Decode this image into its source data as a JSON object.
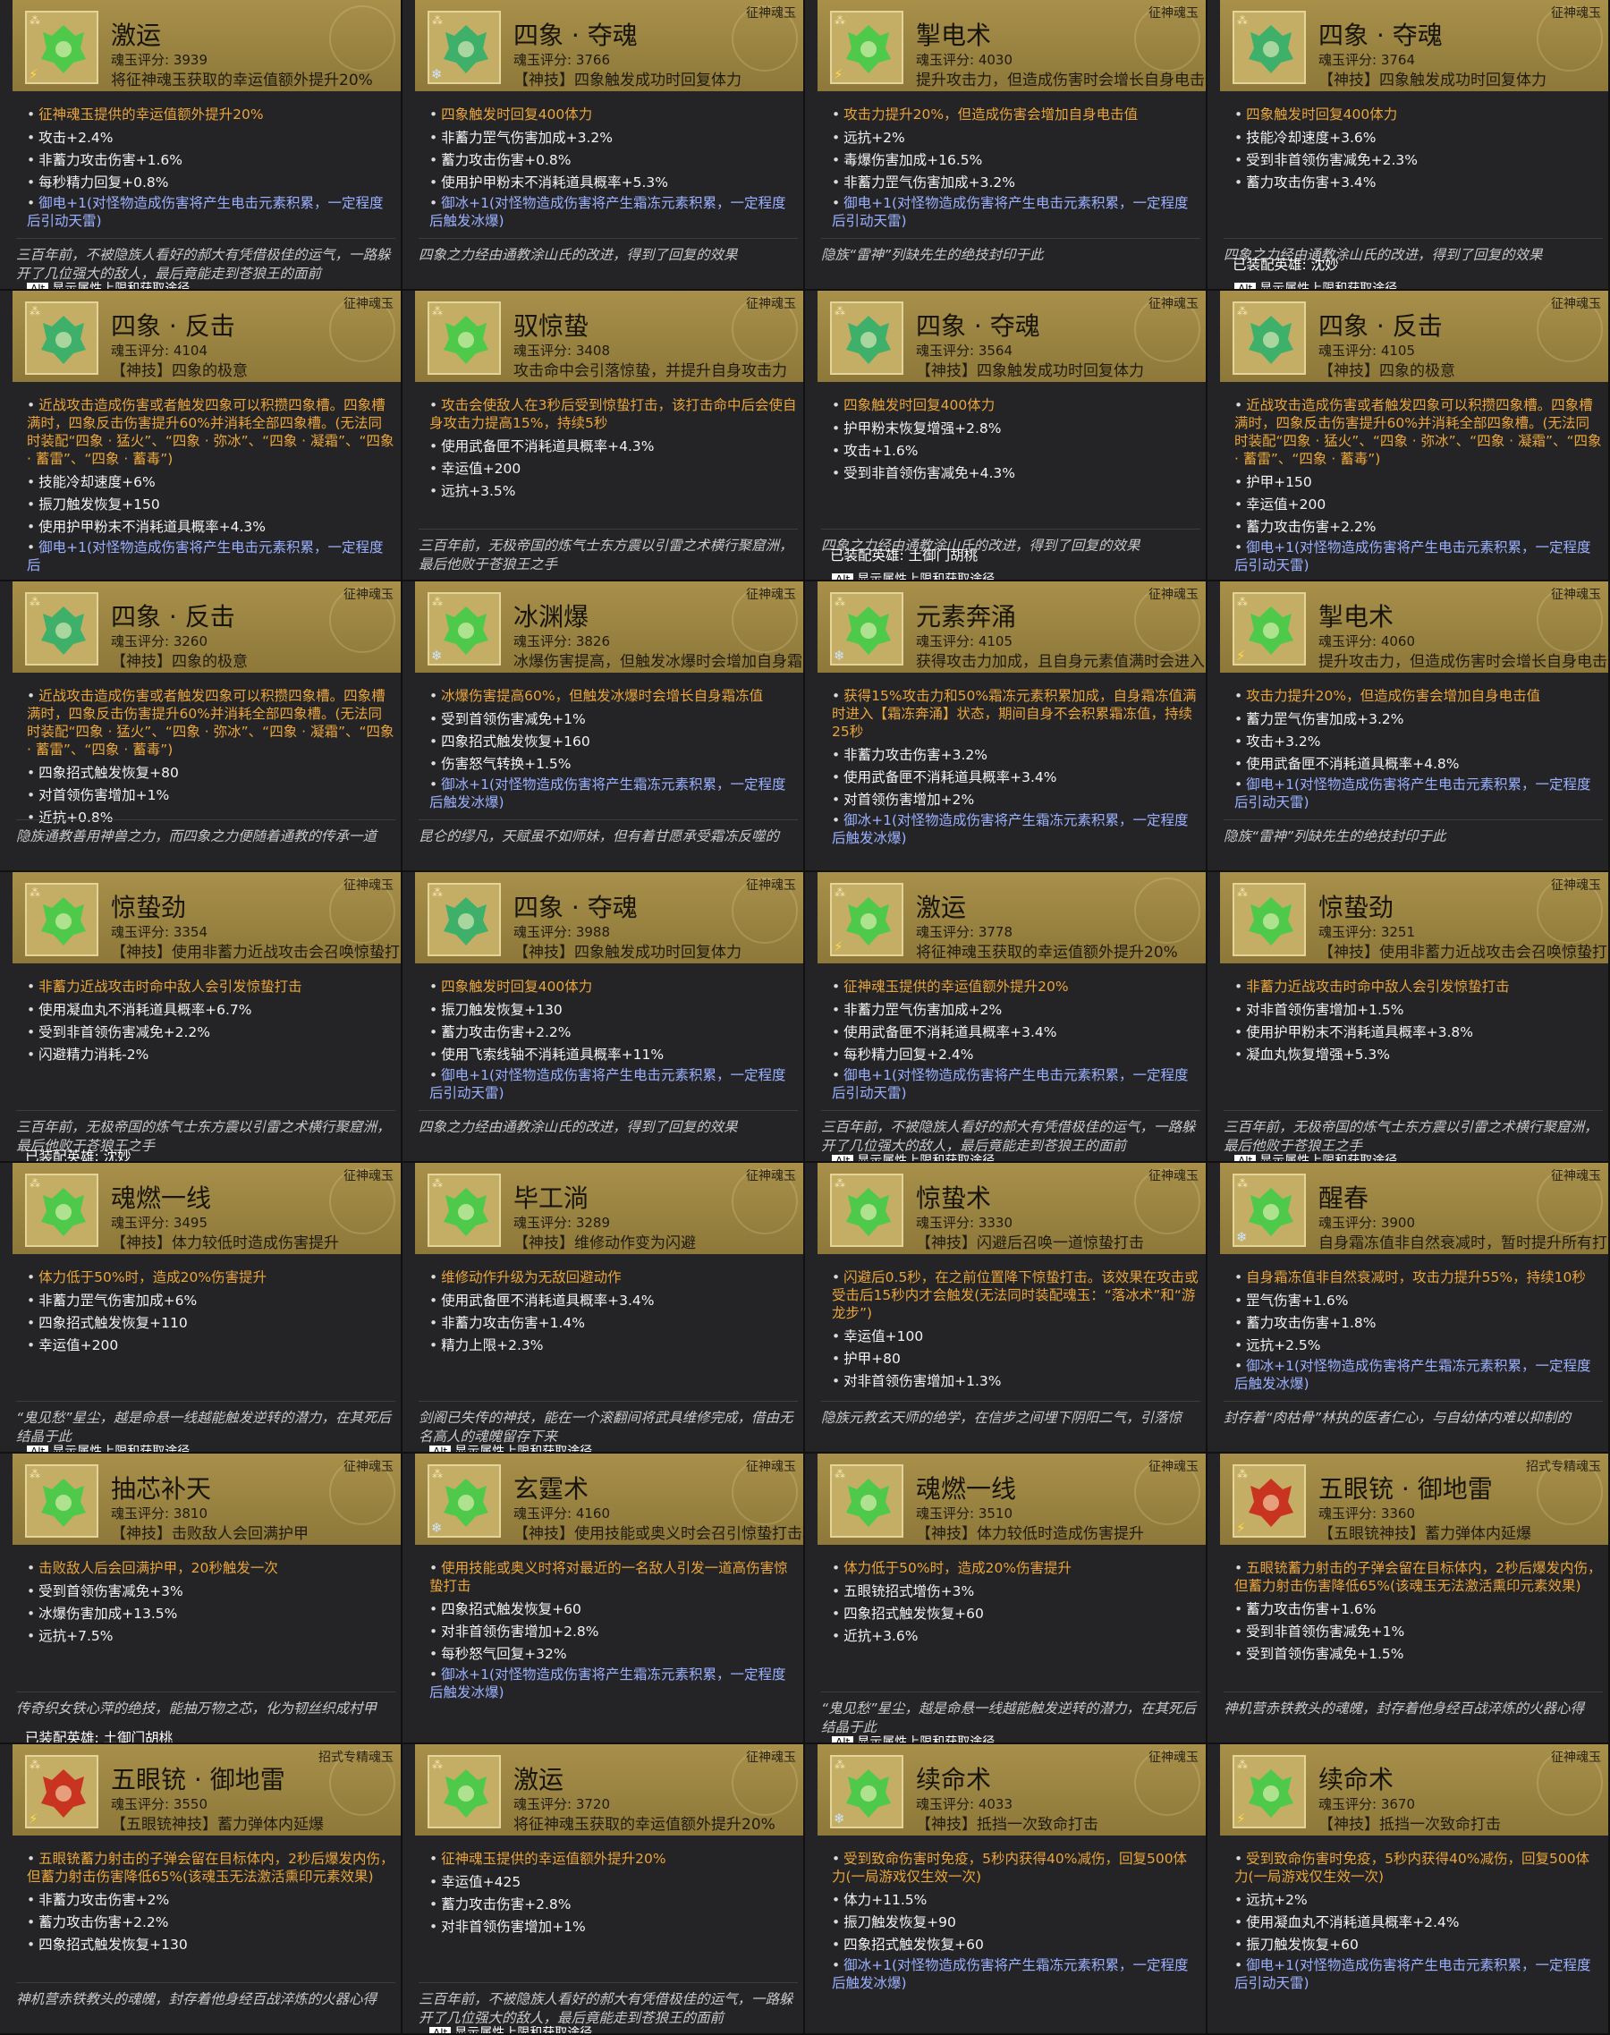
{
  "colors": {
    "header_gold": "#a8904a",
    "panel_dark": "#242426",
    "passive_orange": "#e9a53c",
    "infusion_blue": "#9ab0ff",
    "stat_white": "#f2f2f2",
    "flavor_grey": "#c8c8c8"
  },
  "icon_colors": {
    "green": "#4fc94a",
    "jade": "#3fb06a",
    "red": "#c93420"
  },
  "alt_key": "Alt",
  "alt_hint": "显示属性上限和获取途径",
  "cards": [
    {
      "tag": "",
      "name": "激运",
      "score": "魂玉评分: 3939",
      "skill": "将征神魂玉获取的幸运值额外提升20%",
      "icon": "green",
      "mark": "⚡",
      "lines": [
        {
          "t": "征神魂玉提供的幸运值额外提升20%",
          "c": "orange"
        },
        {
          "t": "攻击+2.4%"
        },
        {
          "t": "非蓄力攻击伤害+1.6%"
        },
        {
          "t": "每秒精力回复+0.8%"
        },
        {
          "t": "御电+1(对怪物造成伤害将产生电击元素积累，一定程度后引动天雷)",
          "c": "blue"
        }
      ],
      "flavor": "三百年前，不被隐族人看好的郝大有凭借极佳的运气，一路躲开了几位强大的敌人，最后竟能走到苍狼王的面前",
      "equip": "",
      "alt": true
    },
    {
      "tag": "征神魂玉",
      "name": "四象 · 夺魂",
      "score": "魂玉评分: 3766",
      "skill": "【神技】四象触发成功时回复体力",
      "icon": "jade",
      "mark": "❄",
      "lines": [
        {
          "t": "四象触发时回复400体力",
          "c": "orange"
        },
        {
          "t": "非蓄力罡气伤害加成+3.2%"
        },
        {
          "t": "蓄力攻击伤害+0.8%"
        },
        {
          "t": "使用护甲粉末不消耗道具概率+5.3%"
        },
        {
          "t": "御冰+1(对怪物造成伤害将产生霜冻元素积累，一定程度后触发冰爆)",
          "c": "blue"
        }
      ],
      "flavor": "四象之力经由通教涂山氏的改进，得到了回复的效果",
      "equip": "",
      "alt": false
    },
    {
      "tag": "征神魂玉",
      "name": "掣电术",
      "score": "魂玉评分: 4030",
      "skill": "提升攻击力，但造成伤害时会增长自身电击值",
      "icon": "green",
      "mark": "⚡",
      "lines": [
        {
          "t": "攻击力提升20%，但造成伤害会增加自身电击值",
          "c": "orange"
        },
        {
          "t": "远抗+2%"
        },
        {
          "t": "毒爆伤害加成+16.5%"
        },
        {
          "t": "非蓄力罡气伤害加成+3.2%"
        },
        {
          "t": "御电+1(对怪物造成伤害将产生电击元素积累，一定程度后引动天雷)",
          "c": "blue"
        }
      ],
      "flavor": "隐族“雷神”列缺先生的绝技封印于此",
      "equip": "",
      "alt": false
    },
    {
      "tag": "征神魂玉",
      "name": "四象 · 夺魂",
      "score": "魂玉评分: 3764",
      "skill": "【神技】四象触发成功时回复体力",
      "icon": "jade",
      "mark": "",
      "lines": [
        {
          "t": "四象触发时回复400体力",
          "c": "orange"
        },
        {
          "t": "技能冷却速度+3.6%"
        },
        {
          "t": "受到非首领伤害减免+2.3%"
        },
        {
          "t": "蓄力攻击伤害+3.4%"
        }
      ],
      "flavor": "四象之力经由通教涂山氏的改进，得到了回复的效果",
      "equip": "已装配英雄: 沈妙",
      "alt": true
    },
    {
      "tag": "征神魂玉",
      "name": "四象 · 反击",
      "score": "魂玉评分: 4104",
      "skill": "【神技】四象的极意",
      "icon": "jade",
      "mark": "",
      "lines": [
        {
          "t": "近战攻击造成伤害或者触发四象可以积攒四象槽。四象槽满时，四象反击伤害提升60%并消耗全部四象槽。(无法同时装配“四象 · 猛火”、“四象 · 弥冰”、“四象 · 凝霜”、“四象 · 蓄雷”、“四象 · 蓄毒”)",
          "c": "orange"
        },
        {
          "t": "技能冷却速度+6%"
        },
        {
          "t": "振刀触发恢复+150"
        },
        {
          "t": "使用护甲粉末不消耗道具概率+4.3%"
        },
        {
          "t": "御电+1(对怪物造成伤害将产生电击元素积累，一定程度后",
          "c": "blue"
        }
      ],
      "flavor": "",
      "equip": "",
      "alt": false
    },
    {
      "tag": "征神魂玉",
      "name": "驭惊蛰",
      "score": "魂玉评分: 3408",
      "skill": "攻击命中会引落惊蛰，并提升自身攻击力",
      "icon": "green",
      "mark": "",
      "lines": [
        {
          "t": "攻击会使敌人在3秒后受到惊蛰打击，该打击命中后会使自身攻击力提高15%，持续5秒",
          "c": "orange"
        },
        {
          "t": "使用武备匣不消耗道具概率+4.3%"
        },
        {
          "t": "幸运值+200"
        },
        {
          "t": "远抗+3.5%"
        }
      ],
      "flavor": "三百年前，无极帝国的炼气士东方震以引雷之术横行聚窟洲，最后他败于苍狼王之手",
      "equip": "",
      "alt": false
    },
    {
      "tag": "征神魂玉",
      "name": "四象 · 夺魂",
      "score": "魂玉评分: 3564",
      "skill": "【神技】四象触发成功时回复体力",
      "icon": "jade",
      "mark": "",
      "lines": [
        {
          "t": "四象触发时回复400体力",
          "c": "orange"
        },
        {
          "t": "护甲粉末恢复增强+2.8%"
        },
        {
          "t": "攻击+1.6%"
        },
        {
          "t": "受到非首领伤害减免+4.3%"
        }
      ],
      "flavor": "四象之力经由通教涂山氏的改进，得到了回复的效果",
      "equip": "已装配英雄: 土御门胡桃",
      "alt": true
    },
    {
      "tag": "征神魂玉",
      "name": "四象 · 反击",
      "score": "魂玉评分: 4105",
      "skill": "【神技】四象的极意",
      "icon": "jade",
      "mark": "",
      "lines": [
        {
          "t": "近战攻击造成伤害或者触发四象可以积攒四象槽。四象槽满时，四象反击伤害提升60%并消耗全部四象槽。(无法同时装配“四象 · 猛火”、“四象 · 弥冰”、“四象 · 凝霜”、“四象 · 蓄雷”、“四象 · 蓄毒”)",
          "c": "orange"
        },
        {
          "t": "护甲+150"
        },
        {
          "t": "幸运值+200"
        },
        {
          "t": "蓄力攻击伤害+2.2%"
        },
        {
          "t": "御电+1(对怪物造成伤害将产生电击元素积累，一定程度后引动天雷)",
          "c": "blue"
        }
      ],
      "flavor": "",
      "equip": "",
      "alt": false
    },
    {
      "tag": "征神魂玉",
      "name": "四象 · 反击",
      "score": "魂玉评分: 3260",
      "skill": "【神技】四象的极意",
      "icon": "jade",
      "mark": "",
      "lines": [
        {
          "t": "近战攻击造成伤害或者触发四象可以积攒四象槽。四象槽满时，四象反击伤害提升60%并消耗全部四象槽。(无法同时装配“四象 · 猛火”、“四象 · 弥冰”、“四象 · 凝霜”、“四象 · 蓄雷”、“四象 · 蓄毒”)",
          "c": "orange"
        },
        {
          "t": "四象招式触发恢复+80"
        },
        {
          "t": "对首领伤害增加+1%"
        },
        {
          "t": "近抗+0.8%"
        }
      ],
      "flavor": "隐族通教善用神兽之力，而四象之力便随着通教的传承一道",
      "equip": "",
      "alt": false
    },
    {
      "tag": "征神魂玉",
      "name": "冰渊爆",
      "score": "魂玉评分: 3826",
      "skill": "冰爆伤害提高，但触发冰爆时会增加自身霜冻值",
      "icon": "green",
      "mark": "❄",
      "lines": [
        {
          "t": "冰爆伤害提高60%，但触发冰爆时会增长自身霜冻值",
          "c": "orange"
        },
        {
          "t": "受到首领伤害减免+1%"
        },
        {
          "t": "四象招式触发恢复+160"
        },
        {
          "t": "伤害怒气转换+1.5%"
        },
        {
          "t": "御冰+1(对怪物造成伤害将产生霜冻元素积累，一定程度后触发冰爆)",
          "c": "blue"
        }
      ],
      "flavor": "昆仑的缪凡，天赋虽不如师妹，但有着甘愿承受霜冻反噬的",
      "equip": "",
      "alt": false
    },
    {
      "tag": "征神魂玉",
      "name": "元素奔涌",
      "score": "魂玉评分: 4105",
      "skill": "获得攻击力加成，且自身元素值满时会进入【元素奔涌】态（效果根据此魂玉元素属性改变）",
      "icon": "green",
      "mark": "❄",
      "lines": [
        {
          "t": "获得15%攻击力和50%霜冻元素积累加成，自身霜冻值满时进入【霜冻奔涌】状态，期间自身不会积累霜冻值，持续25秒",
          "c": "orange"
        },
        {
          "t": "非蓄力攻击伤害+3.2%"
        },
        {
          "t": "使用武备匣不消耗道具概率+3.4%"
        },
        {
          "t": "对首领伤害增加+2%"
        },
        {
          "t": "御冰+1(对怪物造成伤害将产生霜冻元素积累，一定程度后触发冰爆)",
          "c": "blue"
        }
      ],
      "flavor": "",
      "equip": "",
      "alt": false
    },
    {
      "tag": "征神魂玉",
      "name": "掣电术",
      "score": "魂玉评分: 4060",
      "skill": "提升攻击力，但造成伤害时会增长自身电击值",
      "icon": "green",
      "mark": "⚡",
      "lines": [
        {
          "t": "攻击力提升20%，但造成伤害会增加自身电击值",
          "c": "orange"
        },
        {
          "t": "蓄力罡气伤害加成+3.2%"
        },
        {
          "t": "攻击+3.2%"
        },
        {
          "t": "使用武备匣不消耗道具概率+4.8%"
        },
        {
          "t": "御电+1(对怪物造成伤害将产生电击元素积累，一定程度后引动天雷)",
          "c": "blue"
        }
      ],
      "flavor": "隐族“雷神”列缺先生的绝技封印于此",
      "equip": "",
      "alt": false
    },
    {
      "tag": "征神魂玉",
      "name": "惊蛰劲",
      "score": "魂玉评分: 3354",
      "skill": "【神技】使用非蓄力近战攻击会召唤惊蛰打击",
      "icon": "green",
      "mark": "",
      "lines": [
        {
          "t": "非蓄力近战攻击时命中敌人会引发惊蛰打击",
          "c": "orange"
        },
        {
          "t": "使用凝血丸不消耗道具概率+6.7%"
        },
        {
          "t": "受到非首领伤害减免+2.2%"
        },
        {
          "t": "闪避精力消耗-2%"
        }
      ],
      "flavor": "三百年前，无极帝国的炼气士东方震以引雷之术横行聚窟洲，最后他败于苍狼王之手",
      "equip": "已装配英雄: 沈妙",
      "alt": false
    },
    {
      "tag": "征神魂玉",
      "name": "四象 · 夺魂",
      "score": "魂玉评分: 3988",
      "skill": "【神技】四象触发成功时回复体力",
      "icon": "jade",
      "mark": "",
      "lines": [
        {
          "t": "四象触发时回复400体力",
          "c": "orange"
        },
        {
          "t": "振刀触发恢复+130"
        },
        {
          "t": "蓄力攻击伤害+2.2%"
        },
        {
          "t": "使用飞索线轴不消耗道具概率+11%"
        },
        {
          "t": "御电+1(对怪物造成伤害将产生电击元素积累，一定程度后引动天雷)",
          "c": "blue"
        }
      ],
      "flavor": "四象之力经由通教涂山氏的改进，得到了回复的效果",
      "equip": "",
      "alt": false
    },
    {
      "tag": "",
      "name": "激运",
      "score": "魂玉评分: 3778",
      "skill": "将征神魂玉获取的幸运值额外提升20%",
      "icon": "green",
      "mark": "⚡",
      "lines": [
        {
          "t": "征神魂玉提供的幸运值额外提升20%",
          "c": "orange"
        },
        {
          "t": "非蓄力罡气伤害加成+2%"
        },
        {
          "t": "使用武备匣不消耗道具概率+3.4%"
        },
        {
          "t": "每秒精力回复+2.4%"
        },
        {
          "t": "御电+1(对怪物造成伤害将产生电击元素积累，一定程度后引动天雷)",
          "c": "blue"
        }
      ],
      "flavor": "三百年前，不被隐族人看好的郝大有凭借极佳的运气，一路躲开了几位强大的敌人，最后竟能走到苍狼王的面前",
      "equip": "",
      "alt": true
    },
    {
      "tag": "征神魂玉",
      "name": "惊蛰劲",
      "score": "魂玉评分: 3251",
      "skill": "【神技】使用非蓄力近战攻击会召唤惊蛰打击",
      "icon": "green",
      "mark": "",
      "lines": [
        {
          "t": "非蓄力近战攻击时命中敌人会引发惊蛰打击",
          "c": "orange"
        },
        {
          "t": "对非首领伤害增加+1.5%"
        },
        {
          "t": "使用护甲粉末不消耗道具概率+3.8%"
        },
        {
          "t": "凝血丸恢复增强+5.3%"
        }
      ],
      "flavor": "三百年前，无极帝国的炼气士东方震以引雷之术横行聚窟洲，最后他败于苍狼王之手",
      "equip": "",
      "alt": true
    },
    {
      "tag": "征神魂玉",
      "name": "魂燃一线",
      "score": "魂玉评分: 3495",
      "skill": "【神技】体力较低时造成伤害提升",
      "icon": "green",
      "mark": "",
      "lines": [
        {
          "t": "体力低于50%时，造成20%伤害提升",
          "c": "orange"
        },
        {
          "t": "非蓄力罡气伤害加成+6%"
        },
        {
          "t": "四象招式触发恢复+110"
        },
        {
          "t": "幸运值+200"
        }
      ],
      "flavor": "“鬼见愁”星尘，越是命悬一线越能触发逆转的潜力，在其死后结晶于此",
      "equip": "",
      "alt": true
    },
    {
      "tag": "征神魂玉",
      "name": "毕工淌",
      "score": "魂玉评分: 3289",
      "skill": "【神技】维修动作变为闪避",
      "icon": "green",
      "mark": "",
      "lines": [
        {
          "t": "维修动作升级为无敌回避动作",
          "c": "orange"
        },
        {
          "t": "使用武备匣不消耗道具概率+3.4%"
        },
        {
          "t": "非蓄力攻击伤害+1.4%"
        },
        {
          "t": "精力上限+2.3%"
        }
      ],
      "flavor": "剑阁已失传的神技，能在一个滚翻间将武具维修完成，借由无名高人的魂魄留存下来",
      "equip": "",
      "alt": true
    },
    {
      "tag": "征神魂玉",
      "name": "惊蛰术",
      "score": "魂玉评分: 3330",
      "skill": "【神技】闪避后召唤一道惊蛰打击",
      "icon": "green",
      "mark": "",
      "lines": [
        {
          "t": "闪避后0.5秒，在之前位置降下惊蛰打击。该效果在攻击或受击后15秒内才会触发(无法同时装配魂玉：“落冰术”和“游龙步”)",
          "c": "orange"
        },
        {
          "t": "幸运值+100"
        },
        {
          "t": "护甲+80"
        },
        {
          "t": "对非首领伤害增加+1.3%"
        }
      ],
      "flavor": "隐族元教玄天师的绝学，在信步之间埋下阴阳二气，引落惊",
      "equip": "",
      "alt": false
    },
    {
      "tag": "征神魂玉",
      "name": "醒春",
      "score": "魂玉评分: 3900",
      "skill": "自身霜冻值非自然衰减时，暂时提升所有打击伤害",
      "icon": "green",
      "mark": "❄",
      "lines": [
        {
          "t": "自身霜冻值非自然衰减时，攻击力提升55%，持续10秒",
          "c": "orange"
        },
        {
          "t": "罡气伤害+1.6%"
        },
        {
          "t": "蓄力攻击伤害+1.8%"
        },
        {
          "t": "远抗+2.5%"
        },
        {
          "t": "御冰+1(对怪物造成伤害将产生霜冻元素积累，一定程度后触发冰爆)",
          "c": "blue"
        }
      ],
      "flavor": "封存着“肉枯骨”林执的医者仁心，与自幼体内难以抑制的",
      "equip": "",
      "alt": false
    },
    {
      "tag": "征神魂玉",
      "name": "抽芯补天",
      "score": "魂玉评分: 3810",
      "skill": "【神技】击败敌人会回满护甲",
      "icon": "green",
      "mark": "",
      "lines": [
        {
          "t": "击败敌人后会回满护甲，20秒触发一次",
          "c": "orange"
        },
        {
          "t": "受到首领伤害减免+3%"
        },
        {
          "t": "冰爆伤害加成+13.5%"
        },
        {
          "t": "远抗+7.5%"
        }
      ],
      "flavor": "传奇织女铁心萍的绝技，能抽万物之芯，化为韧丝织成村甲",
      "equip": "已装配英雄: 土御门胡桃",
      "alt": false
    },
    {
      "tag": "征神魂玉",
      "name": "玄霆术",
      "score": "魂玉评分: 4160",
      "skill": "【神技】使用技能或奥义时会召引惊蛰打击攻击敌人",
      "icon": "green",
      "mark": "❄",
      "lines": [
        {
          "t": "使用技能或奥义时将对最近的一名敌人引发一道高伤害惊蛰打击",
          "c": "orange"
        },
        {
          "t": "四象招式触发恢复+60"
        },
        {
          "t": "对非首领伤害增加+2.8%"
        },
        {
          "t": "每秒怒气回复+32%"
        },
        {
          "t": "御冰+1(对怪物造成伤害将产生霜冻元素积累，一定程度后触发冰爆)",
          "c": "blue"
        }
      ],
      "flavor": "",
      "equip": "",
      "alt": false
    },
    {
      "tag": "征神魂玉",
      "name": "魂燃一线",
      "score": "魂玉评分: 3510",
      "skill": "【神技】体力较低时造成伤害提升",
      "icon": "green",
      "mark": "",
      "lines": [
        {
          "t": "体力低于50%时，造成20%伤害提升",
          "c": "orange"
        },
        {
          "t": "五眼铳招式增伤+3%"
        },
        {
          "t": "四象招式触发恢复+60"
        },
        {
          "t": "近抗+3.6%"
        }
      ],
      "flavor": "“鬼见愁”星尘，越是命悬一线越能触发逆转的潜力，在其死后结晶于此",
      "equip": "",
      "alt": true
    },
    {
      "tag": "招式专精魂玉",
      "name": "五眼铳 · 御地雷",
      "score": "魂玉评分: 3360",
      "skill": "【五眼铳神技】蓄力弹体内延爆",
      "icon": "red",
      "mark": "⚡",
      "lines": [
        {
          "t": "五眼铳蓄力射击的子弹会留在目标体内，2秒后爆发内伤，但蓄力射击伤害降低65%(该魂玉无法激活熏印元素效果)",
          "c": "orange"
        },
        {
          "t": "蓄力攻击伤害+1.6%"
        },
        {
          "t": "受到非首领伤害减免+1%"
        },
        {
          "t": "受到首领伤害减免+1.5%"
        }
      ],
      "flavor": "神机营赤铁教头的魂魄，封存着他身经百战淬炼的火器心得",
      "equip": "",
      "alt": false
    },
    {
      "tag": "招式专精魂玉",
      "name": "五眼铳 · 御地雷",
      "score": "魂玉评分: 3550",
      "skill": "【五眼铳神技】蓄力弹体内延爆",
      "icon": "red",
      "mark": "⚡",
      "lines": [
        {
          "t": "五眼铳蓄力射击的子弹会留在目标体内，2秒后爆发内伤，但蓄力射击伤害降低65%(该魂玉无法激活熏印元素效果)",
          "c": "orange"
        },
        {
          "t": "非蓄力攻击伤害+2%"
        },
        {
          "t": "蓄力攻击伤害+2.2%"
        },
        {
          "t": "四象招式触发恢复+130"
        }
      ],
      "flavor": "神机营赤铁教头的魂魄，封存着他身经百战淬炼的火器心得",
      "equip": "",
      "alt": false
    },
    {
      "tag": "征神魂玉",
      "name": "激运",
      "score": "魂玉评分: 3720",
      "skill": "将征神魂玉获取的幸运值额外提升20%",
      "icon": "green",
      "mark": "",
      "lines": [
        {
          "t": "征神魂玉提供的幸运值额外提升20%",
          "c": "orange"
        },
        {
          "t": "幸运值+425"
        },
        {
          "t": "蓄力攻击伤害+2.8%"
        },
        {
          "t": "对非首领伤害增加+1%"
        }
      ],
      "flavor": "三百年前，不被隐族人看好的郝大有凭借极佳的运气，一路躲开了几位强大的敌人，最后竟能走到苍狼王的面前",
      "equip": "",
      "alt": true
    },
    {
      "tag": "征神魂玉",
      "name": "续命术",
      "score": "魂玉评分: 4033",
      "skill": "【神技】抵挡一次致命打击",
      "icon": "green",
      "mark": "❄",
      "lines": [
        {
          "t": "受到致命伤害时免疫，5秒内获得40%减伤，回复500体力(一局游戏仅生效一次)",
          "c": "orange"
        },
        {
          "t": "体力+11.5%"
        },
        {
          "t": "振刀触发恢复+90"
        },
        {
          "t": "四象招式触发恢复+60"
        },
        {
          "t": "御冰+1(对怪物造成伤害将产生霜冻元素积累，一定程度后触发冰爆)",
          "c": "blue"
        }
      ],
      "flavor": "",
      "equip": "",
      "alt": false
    },
    {
      "tag": "征神魂玉",
      "name": "续命术",
      "score": "魂玉评分: 3670",
      "skill": "【神技】抵挡一次致命打击",
      "icon": "green",
      "mark": "⚡",
      "lines": [
        {
          "t": "受到致命伤害时免疫，5秒内获得40%减伤，回复500体力(一局游戏仅生效一次)",
          "c": "orange"
        },
        {
          "t": "远抗+2%"
        },
        {
          "t": "使用凝血丸不消耗道具概率+2.4%"
        },
        {
          "t": "振刀触发恢复+60"
        },
        {
          "t": "御电+1(对怪物造成伤害将产生电击元素积累，一定程度后引动天雷)",
          "c": "blue"
        }
      ],
      "flavor": "",
      "equip": "",
      "alt": false
    }
  ]
}
